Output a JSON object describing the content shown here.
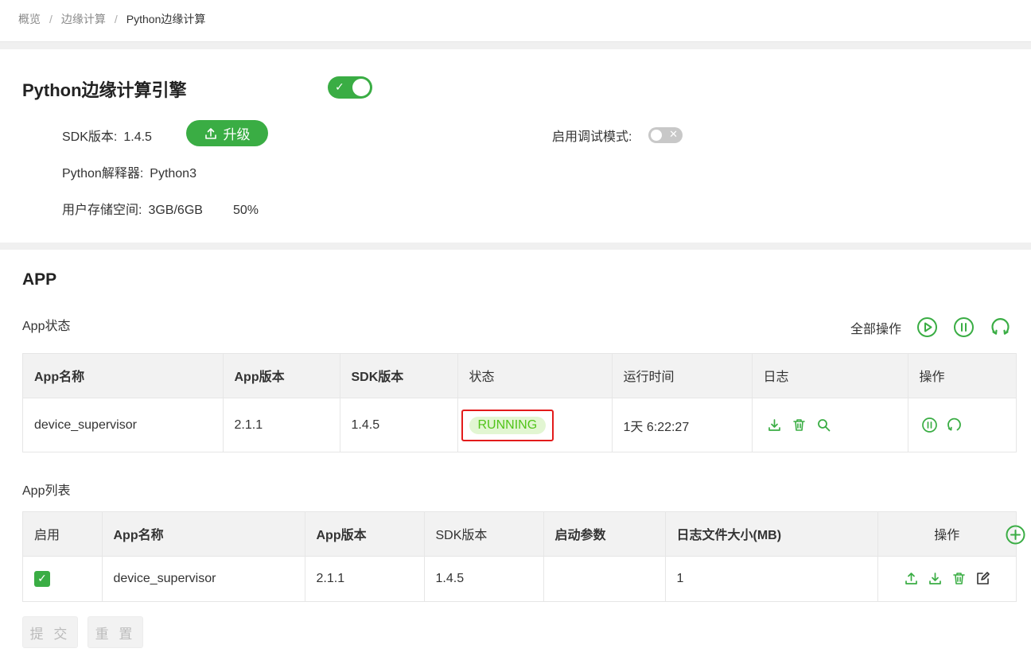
{
  "breadcrumb": {
    "items": [
      "概览",
      "边缘计算",
      "Python边缘计算"
    ],
    "separator": "/"
  },
  "engine": {
    "title": "Python边缘计算引擎",
    "enabled": true,
    "sdk_label": "SDK版本:",
    "sdk_version": "1.4.5",
    "upgrade_label": "升级",
    "interpreter_label": "Python解释器:",
    "interpreter_value": "Python3",
    "storage_label": "用户存储空间:",
    "storage_value": "3GB/6GB",
    "storage_percent": "50%",
    "debug_label": "启用调试模式:",
    "debug_enabled": false
  },
  "app": {
    "title": "APP",
    "status_title": "App状态",
    "all_ops_label": "全部操作",
    "status_table": {
      "headers": [
        "App名称",
        "App版本",
        "SDK版本",
        "状态",
        "运行时间",
        "日志",
        "操作"
      ],
      "rows": [
        {
          "name": "device_supervisor",
          "app_version": "2.1.1",
          "sdk_version": "1.4.5",
          "status": "RUNNING",
          "runtime": "1天 6:22:27"
        }
      ]
    },
    "list_title": "App列表",
    "list_table": {
      "headers": [
        "启用",
        "App名称",
        "App版本",
        "SDK版本",
        "启动参数",
        "日志文件大小(MB)",
        "操作"
      ],
      "rows": [
        {
          "enabled": true,
          "name": "device_supervisor",
          "app_version": "2.1.1",
          "sdk_version": "1.4.5",
          "start_params": "",
          "log_size": "1"
        }
      ]
    },
    "submit_label": "提 交",
    "reset_label": "重 置"
  },
  "colors": {
    "accent": "#3aad44",
    "status_running_bg": "#e2f6d2",
    "status_running_text": "#52c41a",
    "highlight_border": "#e31b1b"
  }
}
